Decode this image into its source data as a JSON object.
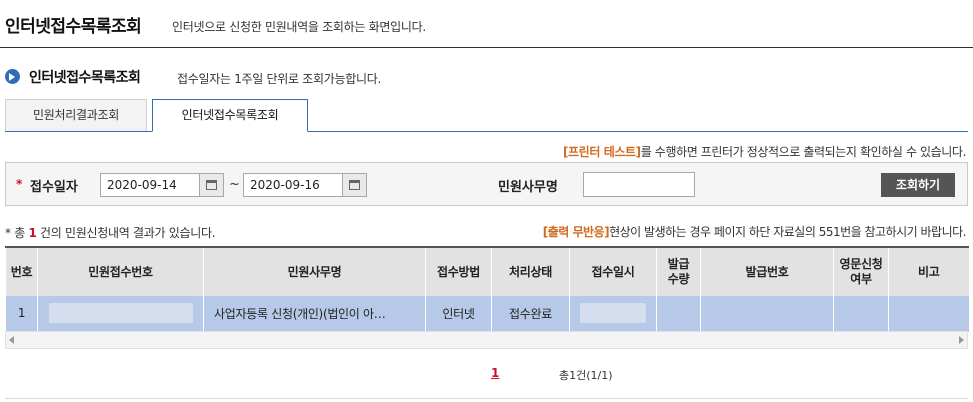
{
  "header": {
    "title": "인터넷접수목록조회",
    "description": "인터넷으로 신청한 민원내역을 조회하는 화면입니다."
  },
  "section": {
    "title": "인터넷접수목록조회",
    "note": "접수일자는 1주일 단위로 조회가능합니다."
  },
  "tabs": [
    {
      "label": "민원처리결과조회",
      "active": false
    },
    {
      "label": "인터넷접수목록조회",
      "active": true
    }
  ],
  "print_note": {
    "link": "[프린터 테스트]",
    "text": "를 수행하면 프린터가 정상적으로 출력되는지 확인하실 수 있습니다."
  },
  "search": {
    "required_mark": "*",
    "date_label": "접수일자",
    "date_from": "2020-09-14",
    "date_to": "2020-09-16",
    "tilde": "~",
    "office_label": "민원사무명",
    "office_value": "",
    "button_label": "조회하기"
  },
  "result": {
    "prefix": "* 총 ",
    "count": "1",
    "suffix": " 건의 민원신청내역 결과가 있습니다."
  },
  "fail_note": {
    "link": "[출력 무반응]",
    "text": "현상이 발생하는 경우 페이지 하단 자료실의 551번을 참고하시기 바랍니다."
  },
  "table": {
    "headers": {
      "no": "번호",
      "receipt_no": "민원접수번호",
      "office_name": "민원사무명",
      "method": "접수방법",
      "status": "처리상태",
      "receipt_date": "접수일시",
      "issue_qty_1": "발급",
      "issue_qty_2": "수량",
      "issue_no": "발급번호",
      "english_1": "영문신청",
      "english_2": "여부",
      "remark": "비고"
    },
    "rows": [
      {
        "no": "1",
        "office_name": "사업자등록 신청(개인)(법인이 아…",
        "method": "인터넷",
        "status": "접수완료",
        "issue_qty": "",
        "issue_no": "",
        "english": "",
        "remark": ""
      }
    ]
  },
  "pagination": {
    "current": "1",
    "total": "총1건(1/1)"
  },
  "colors": {
    "accent": "#2f6db5",
    "selected_row": "#b7c9e8",
    "orange_link": "#d2691e",
    "count_red": "#c8102e",
    "button_dark": "#555555"
  }
}
